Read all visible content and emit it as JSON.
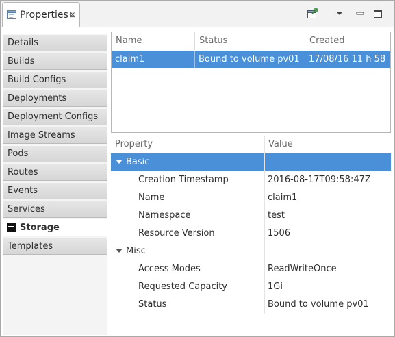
{
  "tab": {
    "label": "Properties",
    "close": "⊠"
  },
  "sidebar": {
    "items": [
      {
        "label": "Details"
      },
      {
        "label": "Builds"
      },
      {
        "label": "Build Configs"
      },
      {
        "label": "Deployments"
      },
      {
        "label": "Deployment Configs"
      },
      {
        "label": "Image Streams"
      },
      {
        "label": "Pods"
      },
      {
        "label": "Routes"
      },
      {
        "label": "Events"
      },
      {
        "label": "Services"
      },
      {
        "label": "Storage"
      },
      {
        "label": "Templates"
      }
    ],
    "selected": "Storage"
  },
  "table": {
    "headers": [
      "Name",
      "Status",
      "Created"
    ],
    "rows": [
      {
        "name": "claim1",
        "status": "Bound to volume pv01",
        "created": "17/08/16 11 h 58"
      }
    ]
  },
  "properties": {
    "headers": [
      "Property",
      "Value"
    ],
    "groups": [
      {
        "label": "Basic",
        "rows": [
          {
            "key": "Creation Timestamp",
            "value": "2016-08-17T09:58:47Z"
          },
          {
            "key": "Name",
            "value": "claim1"
          },
          {
            "key": "Namespace",
            "value": "test"
          },
          {
            "key": "Resource Version",
            "value": "1506"
          }
        ]
      },
      {
        "label": "Misc",
        "rows": [
          {
            "key": "Access Modes",
            "value": "ReadWriteOnce"
          },
          {
            "key": "Requested Capacity",
            "value": "1Gi"
          },
          {
            "key": "Status",
            "value": "Bound to volume pv01"
          }
        ]
      }
    ]
  },
  "colors": {
    "selection": "#4a90d9"
  }
}
